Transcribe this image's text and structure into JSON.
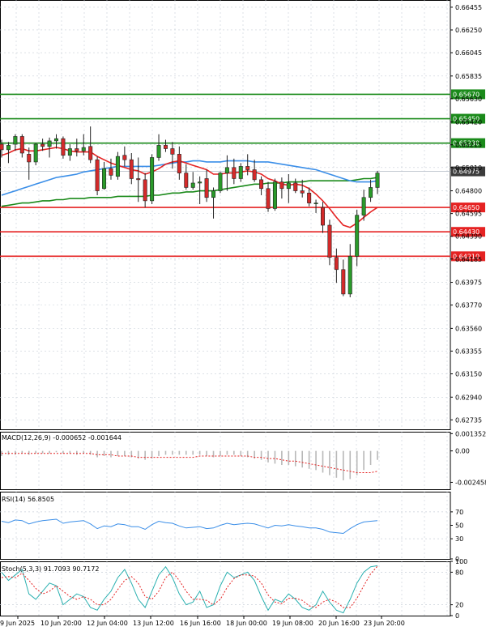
{
  "chart_data": {
    "type": "candlestick",
    "main": {
      "ylim": [
        0.6265,
        0.6652
      ],
      "y_ticks": [
        "0.66455",
        "0.66250",
        "0.66045",
        "0.65835",
        "0.65630",
        "0.65420",
        "0.65215",
        "0.65010",
        "0.64800",
        "0.64595",
        "0.64390",
        "0.64185",
        "0.63975",
        "0.63770",
        "0.63560",
        "0.63355",
        "0.63150",
        "0.62940",
        "0.62735"
      ],
      "levels": [
        {
          "value": 0.6567,
          "label": "0.65670",
          "color": "#1a8a1a"
        },
        {
          "value": 0.6545,
          "label": "0.65450",
          "color": "#1a8a1a"
        },
        {
          "value": 0.6523,
          "label": "0.65230",
          "color": "#1a8a1a"
        },
        {
          "value": 0.6465,
          "label": "0.64650",
          "color": "#e52222"
        },
        {
          "value": 0.6443,
          "label": "0.64430",
          "color": "#e52222"
        },
        {
          "value": 0.6421,
          "label": "0.64210",
          "color": "#e52222"
        }
      ],
      "current_price": {
        "value": 0.64975,
        "label": "0.64975",
        "color": "#3b3b3b"
      },
      "candles": [
        [
          0.6522,
          0.6526,
          0.651,
          0.6517
        ],
        [
          0.6517,
          0.6524,
          0.6505,
          0.6521
        ],
        [
          0.6522,
          0.6531,
          0.6516,
          0.6529
        ],
        [
          0.6529,
          0.6531,
          0.651,
          0.6514
        ],
        [
          0.6513,
          0.6519,
          0.649,
          0.6506
        ],
        [
          0.6506,
          0.6523,
          0.6503,
          0.6522
        ],
        [
          0.6522,
          0.6527,
          0.6516,
          0.652
        ],
        [
          0.652,
          0.6528,
          0.651,
          0.6525
        ],
        [
          0.6525,
          0.6531,
          0.6518,
          0.6527
        ],
        [
          0.6527,
          0.6529,
          0.6509,
          0.6512
        ],
        [
          0.6512,
          0.6522,
          0.6507,
          0.6518
        ],
        [
          0.6518,
          0.6527,
          0.6511,
          0.6516
        ],
        [
          0.6516,
          0.6531,
          0.6512,
          0.6519
        ],
        [
          0.652,
          0.6538,
          0.6505,
          0.6508
        ],
        [
          0.6508,
          0.6511,
          0.6476,
          0.648
        ],
        [
          0.6482,
          0.6506,
          0.6481,
          0.65
        ],
        [
          0.65,
          0.6509,
          0.649,
          0.6494
        ],
        [
          0.6493,
          0.6515,
          0.649,
          0.6511
        ],
        [
          0.6512,
          0.652,
          0.6502,
          0.6508
        ],
        [
          0.6508,
          0.6514,
          0.6486,
          0.6491
        ],
        [
          0.6491,
          0.651,
          0.647,
          0.649
        ],
        [
          0.649,
          0.6496,
          0.6465,
          0.6471
        ],
        [
          0.6471,
          0.6513,
          0.6468,
          0.651
        ],
        [
          0.651,
          0.6531,
          0.6507,
          0.6521
        ],
        [
          0.6521,
          0.6526,
          0.6515,
          0.6518
        ],
        [
          0.6518,
          0.6524,
          0.65,
          0.6513
        ],
        [
          0.6513,
          0.652,
          0.649,
          0.6496
        ],
        [
          0.6496,
          0.6504,
          0.6481,
          0.6483
        ],
        [
          0.6483,
          0.6497,
          0.6481,
          0.6487
        ],
        [
          0.6487,
          0.6493,
          0.6468,
          0.6488
        ],
        [
          0.6491,
          0.6499,
          0.647,
          0.6474
        ],
        [
          0.6474,
          0.6483,
          0.6455,
          0.648
        ],
        [
          0.648,
          0.6497,
          0.6478,
          0.6496
        ],
        [
          0.6496,
          0.6512,
          0.648,
          0.6501
        ],
        [
          0.6501,
          0.6509,
          0.6486,
          0.6491
        ],
        [
          0.6491,
          0.6505,
          0.6488,
          0.6502
        ],
        [
          0.6502,
          0.6513,
          0.6494,
          0.6499
        ],
        [
          0.6499,
          0.6508,
          0.6488,
          0.649
        ],
        [
          0.649,
          0.6493,
          0.6476,
          0.6482
        ],
        [
          0.6482,
          0.6488,
          0.6461,
          0.6464
        ],
        [
          0.6464,
          0.6491,
          0.6462,
          0.6488
        ],
        [
          0.6488,
          0.6492,
          0.6473,
          0.6482
        ],
        [
          0.6482,
          0.6495,
          0.6469,
          0.6487
        ],
        [
          0.6487,
          0.6491,
          0.6478,
          0.648
        ],
        [
          0.648,
          0.649,
          0.6474,
          0.6478
        ],
        [
          0.6478,
          0.6483,
          0.6466,
          0.6469
        ],
        [
          0.6469,
          0.6472,
          0.646,
          0.6469
        ],
        [
          0.6465,
          0.647,
          0.6442,
          0.6449
        ],
        [
          0.6449,
          0.6454,
          0.6413,
          0.642
        ],
        [
          0.642,
          0.6428,
          0.6397,
          0.6409
        ],
        [
          0.6409,
          0.6418,
          0.6385,
          0.6387
        ],
        [
          0.6387,
          0.6432,
          0.6384,
          0.6421
        ],
        [
          0.6421,
          0.6463,
          0.6412,
          0.6458
        ],
        [
          0.6458,
          0.6481,
          0.6453,
          0.6474
        ],
        [
          0.6474,
          0.649,
          0.647,
          0.6483
        ],
        [
          0.6483,
          0.6498,
          0.6477,
          0.6496
        ]
      ],
      "ma_slow": {
        "name": "MA slow",
        "color": "#1a8a1a",
        "values": [
          0.6466,
          0.6467,
          0.6468,
          0.6469,
          0.6469,
          0.647,
          0.6471,
          0.6471,
          0.6472,
          0.6472,
          0.6473,
          0.6473,
          0.6473,
          0.6474,
          0.6474,
          0.6474,
          0.6474,
          0.6475,
          0.6475,
          0.6475,
          0.6475,
          0.6475,
          0.6476,
          0.6476,
          0.6477,
          0.6478,
          0.6478,
          0.6479,
          0.6479,
          0.648,
          0.648,
          0.648,
          0.6481,
          0.6482,
          0.6483,
          0.6484,
          0.6485,
          0.6486,
          0.6486,
          0.6487,
          0.6487,
          0.6487,
          0.6488,
          0.6488,
          0.6488,
          0.6489,
          0.6489,
          0.6489,
          0.6489,
          0.6489,
          0.6489,
          0.6489,
          0.649,
          0.6491,
          0.6491,
          0.6492
        ]
      },
      "ma_mid": {
        "name": "MA mid",
        "color": "#3a8ee8",
        "values": [
          0.6476,
          0.6478,
          0.648,
          0.6482,
          0.6484,
          0.6486,
          0.6488,
          0.649,
          0.6492,
          0.6493,
          0.6494,
          0.6495,
          0.6497,
          0.6498,
          0.6499,
          0.65,
          0.6501,
          0.6502,
          0.6502,
          0.6502,
          0.6502,
          0.6502,
          0.6502,
          0.6503,
          0.6504,
          0.6505,
          0.6506,
          0.6506,
          0.6507,
          0.6507,
          0.6506,
          0.6506,
          0.6506,
          0.6507,
          0.6507,
          0.6507,
          0.6507,
          0.6506,
          0.6506,
          0.6506,
          0.6505,
          0.6504,
          0.6503,
          0.6502,
          0.6501,
          0.65,
          0.6499,
          0.6497,
          0.6495,
          0.6493,
          0.6491,
          0.6489,
          0.6488,
          0.6488,
          0.6488,
          0.6489
        ]
      },
      "ma_fast": {
        "name": "MA fast",
        "color": "#e52222",
        "values": [
          0.6512,
          0.6514,
          0.6517,
          0.6518,
          0.6516,
          0.6516,
          0.6517,
          0.6518,
          0.6519,
          0.6518,
          0.6516,
          0.6515,
          0.6515,
          0.6515,
          0.6511,
          0.6508,
          0.6505,
          0.6503,
          0.6501,
          0.6499,
          0.6498,
          0.6495,
          0.6497,
          0.65,
          0.6504,
          0.6506,
          0.6507,
          0.6505,
          0.6503,
          0.6501,
          0.6499,
          0.6495,
          0.6495,
          0.6496,
          0.6496,
          0.6497,
          0.6498,
          0.6497,
          0.6495,
          0.6491,
          0.6489,
          0.6486,
          0.6485,
          0.6486,
          0.6485,
          0.6482,
          0.6477,
          0.6471,
          0.6464,
          0.6456,
          0.6449,
          0.6447,
          0.6451,
          0.6456,
          0.6461,
          0.6465
        ]
      }
    },
    "macd": {
      "label": "MACD(12,26,9) -0.000652 -0.001644",
      "ylim": [
        -0.003,
        0.0015
      ],
      "y_ticks": [
        "0.001352",
        "0.00",
        "-0.002458"
      ],
      "hist": [
        -0.0004,
        -0.0003,
        -0.0003,
        -0.0002,
        -0.0003,
        -0.0002,
        -0.0002,
        -0.0002,
        -0.0001,
        -0.0002,
        -0.0002,
        -0.0003,
        -0.0002,
        -0.0003,
        -0.0005,
        -0.0004,
        -0.0005,
        -0.0004,
        -0.0004,
        -0.0005,
        -0.0006,
        -0.0007,
        -0.0006,
        -0.0004,
        -0.0003,
        -0.0003,
        -0.0003,
        -0.0003,
        -0.0003,
        -0.0003,
        -0.0004,
        -0.0005,
        -0.0004,
        -0.0003,
        -0.0003,
        -0.0004,
        -0.0005,
        -0.0006,
        -0.0007,
        -0.0009,
        -0.001,
        -0.0011,
        -0.0011,
        -0.0012,
        -0.0013,
        -0.0014,
        -0.0015,
        -0.0017,
        -0.0019,
        -0.0021,
        -0.0023,
        -0.0022,
        -0.0019,
        -0.0015,
        -0.0011,
        -0.0007
      ],
      "signal": [
        -0.0002,
        -0.0002,
        -0.0002,
        -0.0002,
        -0.0002,
        -0.0002,
        -0.0002,
        -0.0002,
        -0.0002,
        -0.0002,
        -0.0002,
        -0.0002,
        -0.0002,
        -0.0002,
        -0.0003,
        -0.0003,
        -0.0003,
        -0.0004,
        -0.0004,
        -0.0004,
        -0.0005,
        -0.0005,
        -0.0005,
        -0.0005,
        -0.0005,
        -0.0005,
        -0.0005,
        -0.0005,
        -0.0005,
        -0.0004,
        -0.0004,
        -0.0004,
        -0.0004,
        -0.0004,
        -0.0004,
        -0.0004,
        -0.0004,
        -0.0005,
        -0.0005,
        -0.0006,
        -0.0006,
        -0.0007,
        -0.0008,
        -0.0008,
        -0.0009,
        -0.001,
        -0.0011,
        -0.0012,
        -0.0013,
        -0.0014,
        -0.0015,
        -0.0016,
        -0.0017,
        -0.0017,
        -0.0017,
        -0.0016
      ]
    },
    "rsi": {
      "label": "RSI(14) 56.8505",
      "ylim": [
        0,
        100
      ],
      "y_ticks": [
        "70",
        "50",
        "30",
        "0"
      ],
      "values": [
        56,
        54,
        58,
        57,
        52,
        55,
        57,
        58,
        59,
        53,
        55,
        56,
        57,
        52,
        45,
        49,
        48,
        52,
        51,
        48,
        48,
        44,
        51,
        56,
        54,
        53,
        49,
        46,
        47,
        48,
        45,
        46,
        50,
        53,
        51,
        52,
        53,
        52,
        49,
        46,
        50,
        49,
        51,
        49,
        48,
        46,
        46,
        44,
        40,
        39,
        38,
        45,
        51,
        55,
        56,
        57
      ]
    },
    "stoch": {
      "label": "Stoch(5,3,3) 91.7093 90.7172",
      "ylim": [
        0,
        100
      ],
      "y_ticks": [
        "100",
        "80",
        "20",
        "0"
      ],
      "k": [
        80,
        65,
        75,
        85,
        40,
        30,
        45,
        60,
        55,
        20,
        30,
        40,
        35,
        15,
        10,
        30,
        45,
        70,
        85,
        60,
        30,
        15,
        45,
        75,
        90,
        70,
        40,
        20,
        25,
        45,
        15,
        20,
        55,
        80,
        70,
        75,
        80,
        65,
        35,
        10,
        30,
        25,
        40,
        30,
        15,
        10,
        20,
        45,
        25,
        10,
        5,
        30,
        60,
        80,
        90,
        92
      ],
      "d": [
        70,
        72,
        70,
        78,
        65,
        50,
        40,
        45,
        55,
        45,
        35,
        30,
        35,
        30,
        20,
        20,
        30,
        48,
        65,
        72,
        60,
        35,
        30,
        45,
        70,
        80,
        65,
        45,
        30,
        30,
        28,
        20,
        30,
        52,
        68,
        75,
        75,
        73,
        60,
        38,
        25,
        22,
        32,
        32,
        28,
        18,
        15,
        25,
        30,
        25,
        15,
        15,
        32,
        55,
        77,
        91
      ]
    },
    "x_labels": [
      "9 Jun 2025",
      "10 Jun 20:00",
      "12 Jun 04:00",
      "13 Jun 12:00",
      "16 Jun 16:00",
      "18 Jun 00:00",
      "19 Jun 08:00",
      "20 Jun 16:00",
      "23 Jun 20:00"
    ]
  }
}
